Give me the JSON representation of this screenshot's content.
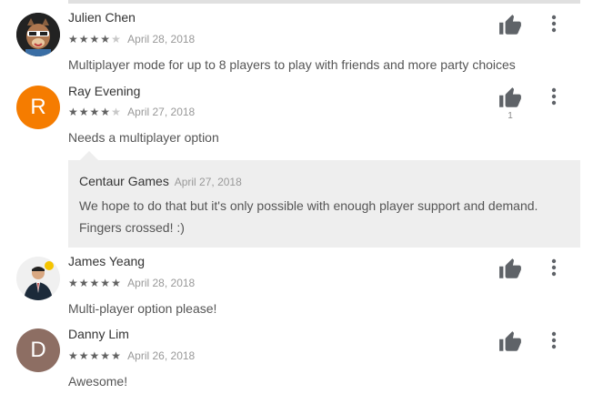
{
  "reviews": [
    {
      "author": "Julien Chen",
      "rating": 4,
      "date": "April 28, 2018",
      "text": "Multiplayer mode for up to 8 players to play with friends and more party choices",
      "avatar_type": "image-dog"
    },
    {
      "author": "Ray Evening",
      "rating": 4,
      "date": "April 27, 2018",
      "text": "Needs a multiplayer option",
      "avatar_letter": "R",
      "avatar_color": "#f57c00",
      "helpful_count": "1",
      "reply": {
        "developer": "Centaur Games",
        "date": "April 27, 2018",
        "text": "We hope to do that but it's only possible with enough player support and demand. Fingers crossed! :)"
      }
    },
    {
      "author": "James Yeang",
      "rating": 5,
      "date": "April 28, 2018",
      "text": "Multi-player option please!",
      "avatar_type": "image-person"
    },
    {
      "author": "Danny Lim",
      "rating": 5,
      "date": "April 26, 2018",
      "text": "Awesome!",
      "avatar_letter": "D",
      "avatar_color": "#8d6e63"
    }
  ],
  "icons": {
    "thumb": "thumbs-up-icon",
    "more": "more-vert-icon"
  },
  "colors": {
    "icon": "#5f6368",
    "reply_bg": "#eeeeee"
  }
}
